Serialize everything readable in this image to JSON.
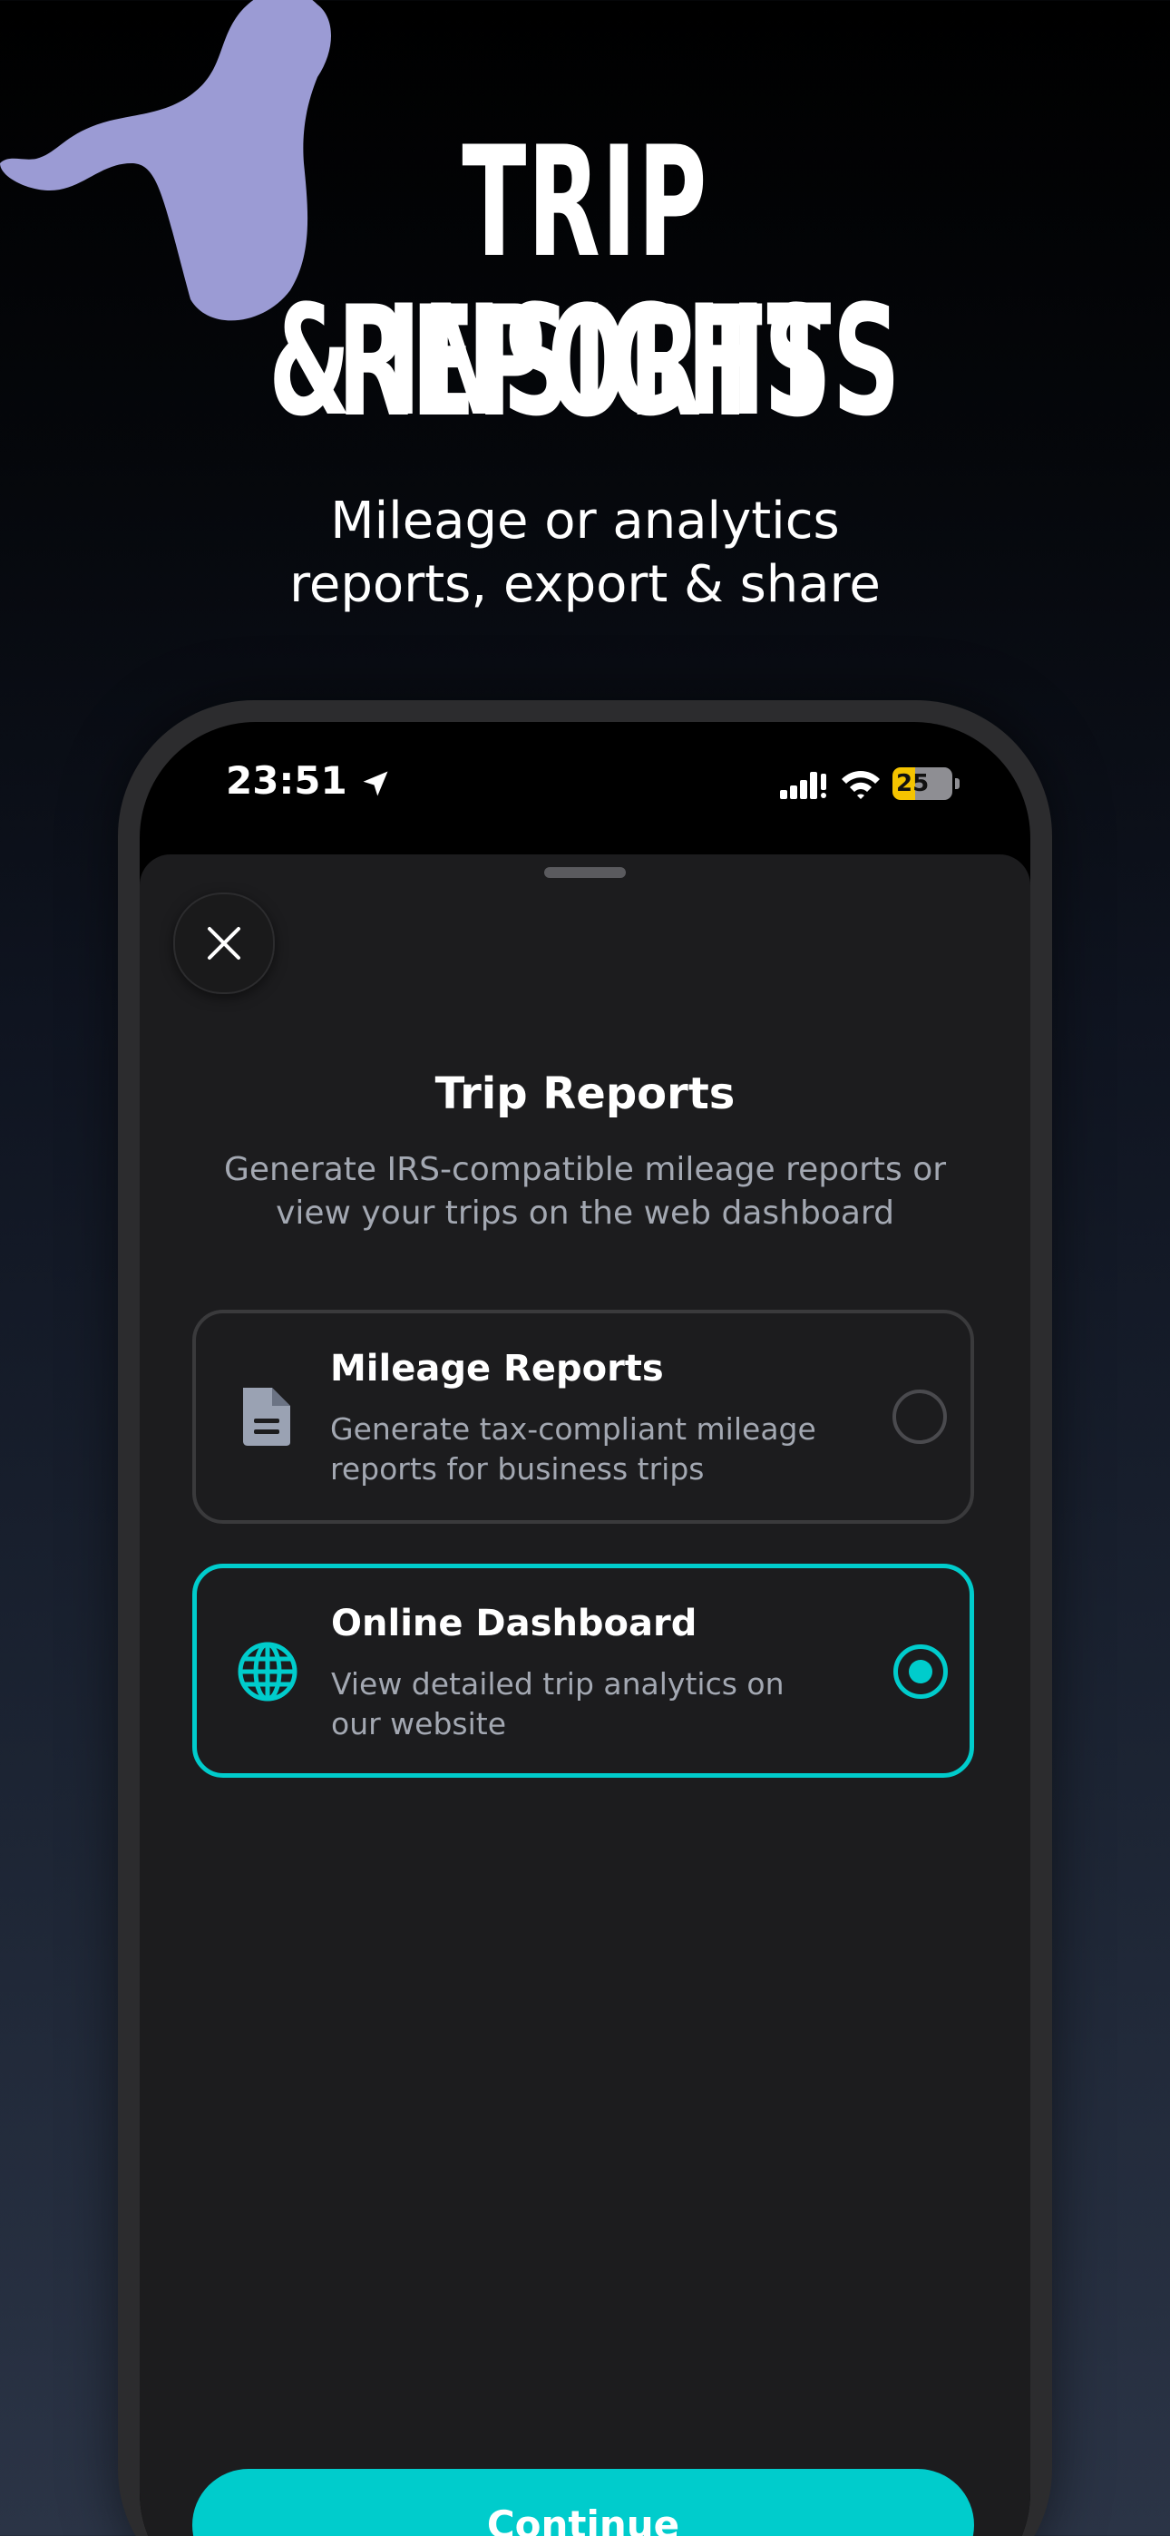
{
  "hero": {
    "title_line1": "TRIP REPORTS",
    "title_line2": "& INSIGHTS",
    "subtitle_line1": "Mileage or analytics",
    "subtitle_line2": "reports, export & share"
  },
  "status_bar": {
    "time": "23:51",
    "battery": "25",
    "icons": [
      "location-arrow-icon",
      "signal-icon",
      "wifi-icon",
      "battery-charging-icon"
    ]
  },
  "sheet": {
    "title": "Trip Reports",
    "description_line1": "Generate IRS-compatible mileage reports or",
    "description_line2": "view your trips on the web dashboard",
    "close_icon": "close-icon"
  },
  "options": [
    {
      "title": "Mileage Reports",
      "desc_line1": "Generate tax-compliant mileage",
      "desc_line2": "reports for business trips",
      "icon": "document-icon",
      "selected": false
    },
    {
      "title": "Online Dashboard",
      "desc_line1": "View detailed trip analytics on",
      "desc_line2": "our website",
      "icon": "globe-icon",
      "selected": true
    }
  ],
  "continue_label": "Continue",
  "colors": {
    "accent": "#00cccc",
    "blob": "#9b9bd4",
    "sheet_bg": "#1c1c1e",
    "muted_text": "#a3a8b2"
  }
}
